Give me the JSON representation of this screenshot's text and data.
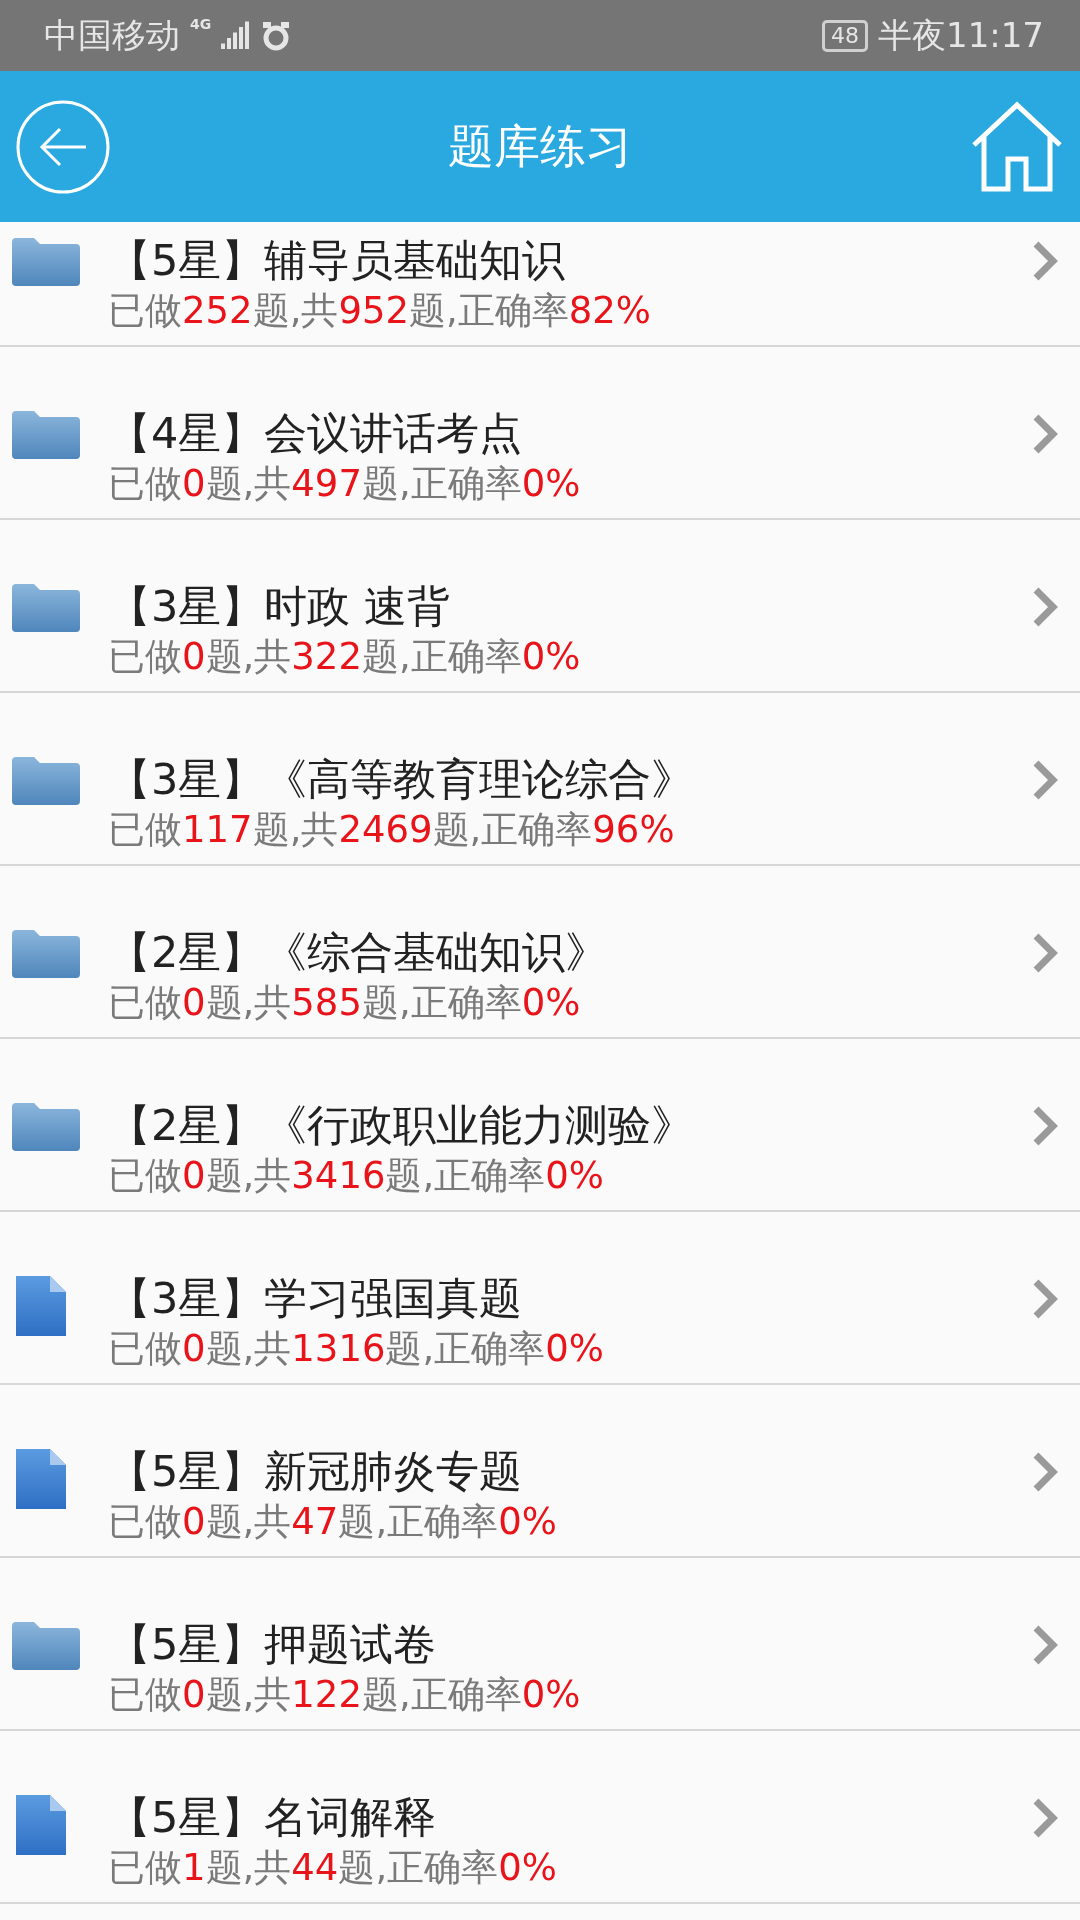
{
  "status_bar": {
    "carrier": "中国移动",
    "network": "4G",
    "battery": "48",
    "time": "半夜11:17"
  },
  "header": {
    "title": "题库练习"
  },
  "items": [
    {
      "kind": "folder",
      "title": "【5星】辅导员基础知识",
      "stats": [
        {
          "text": "已做",
          "highlight": false
        },
        {
          "text": "252",
          "highlight": true
        },
        {
          "text": "题,共",
          "highlight": false
        },
        {
          "text": "952",
          "highlight": true
        },
        {
          "text": "题,正确率",
          "highlight": false
        },
        {
          "text": "82%",
          "highlight": true
        }
      ]
    },
    {
      "kind": "folder",
      "title": "【4星】会议讲话考点",
      "stats": [
        {
          "text": "已做",
          "highlight": false
        },
        {
          "text": "0",
          "highlight": true
        },
        {
          "text": "题,共",
          "highlight": false
        },
        {
          "text": "497",
          "highlight": true
        },
        {
          "text": "题,正确率",
          "highlight": false
        },
        {
          "text": "0%",
          "highlight": true
        }
      ]
    },
    {
      "kind": "folder",
      "title": "【3星】时政 速背",
      "stats": [
        {
          "text": "已做",
          "highlight": false
        },
        {
          "text": "0",
          "highlight": true
        },
        {
          "text": "题,共",
          "highlight": false
        },
        {
          "text": "322",
          "highlight": true
        },
        {
          "text": "题,正确率",
          "highlight": false
        },
        {
          "text": "0%",
          "highlight": true
        }
      ]
    },
    {
      "kind": "folder",
      "title": "【3星】《高等教育理论综合》",
      "stats": [
        {
          "text": "已做",
          "highlight": false
        },
        {
          "text": "117",
          "highlight": true
        },
        {
          "text": "题,共",
          "highlight": false
        },
        {
          "text": "2469",
          "highlight": true
        },
        {
          "text": "题,正确率",
          "highlight": false
        },
        {
          "text": "96%",
          "highlight": true
        }
      ]
    },
    {
      "kind": "folder",
      "title": "【2星】《综合基础知识》",
      "stats": [
        {
          "text": "已做",
          "highlight": false
        },
        {
          "text": "0",
          "highlight": true
        },
        {
          "text": "题,共",
          "highlight": false
        },
        {
          "text": "585",
          "highlight": true
        },
        {
          "text": "题,正确率",
          "highlight": false
        },
        {
          "text": "0%",
          "highlight": true
        }
      ]
    },
    {
      "kind": "folder",
      "title": "【2星】《行政职业能力测验》",
      "stats": [
        {
          "text": "已做",
          "highlight": false
        },
        {
          "text": "0",
          "highlight": true
        },
        {
          "text": "题,共",
          "highlight": false
        },
        {
          "text": "3416",
          "highlight": true
        },
        {
          "text": "题,正确率",
          "highlight": false
        },
        {
          "text": "0%",
          "highlight": true
        }
      ]
    },
    {
      "kind": "file",
      "title": "【3星】学习强国真题",
      "stats": [
        {
          "text": "已做",
          "highlight": false
        },
        {
          "text": "0",
          "highlight": true
        },
        {
          "text": "题,共",
          "highlight": false
        },
        {
          "text": "1316",
          "highlight": true
        },
        {
          "text": "题,正确率",
          "highlight": false
        },
        {
          "text": "0%",
          "highlight": true
        }
      ]
    },
    {
      "kind": "file",
      "title": "【5星】新冠肺炎专题",
      "stats": [
        {
          "text": "已做",
          "highlight": false
        },
        {
          "text": "0",
          "highlight": true
        },
        {
          "text": "题,共",
          "highlight": false
        },
        {
          "text": "47",
          "highlight": true
        },
        {
          "text": "题,正确率",
          "highlight": false
        },
        {
          "text": "0%",
          "highlight": true
        }
      ]
    },
    {
      "kind": "folder",
      "title": "【5星】押题试卷",
      "stats": [
        {
          "text": "已做",
          "highlight": false
        },
        {
          "text": "0",
          "highlight": true
        },
        {
          "text": "题,共",
          "highlight": false
        },
        {
          "text": "122",
          "highlight": true
        },
        {
          "text": "题,正确率",
          "highlight": false
        },
        {
          "text": "0%",
          "highlight": true
        }
      ]
    },
    {
      "kind": "file",
      "title": "【5星】名词解释",
      "stats": [
        {
          "text": "已做",
          "highlight": false
        },
        {
          "text": "1",
          "highlight": true
        },
        {
          "text": "题,共",
          "highlight": false
        },
        {
          "text": "44",
          "highlight": true
        },
        {
          "text": "题,正确率",
          "highlight": false
        },
        {
          "text": "0%",
          "highlight": true
        }
      ]
    }
  ]
}
